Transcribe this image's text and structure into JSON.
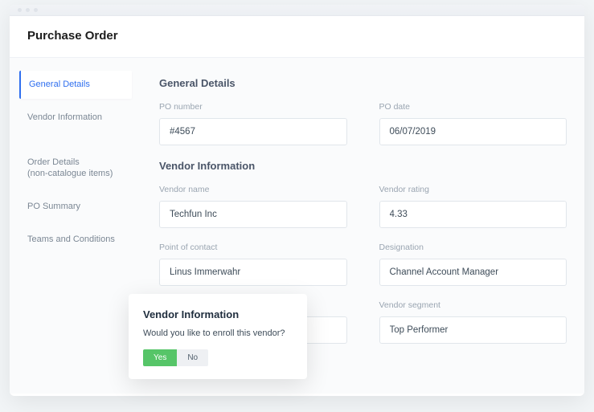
{
  "header": {
    "title": "Purchase Order"
  },
  "sidebar": {
    "items": [
      {
        "label": "General Details",
        "active": true
      },
      {
        "label": "Vendor Information"
      },
      {
        "label": "Order Details\n(non-catalogue items)"
      },
      {
        "label": "PO Summary"
      },
      {
        "label": "Teams and Conditions"
      }
    ]
  },
  "sections": {
    "general": {
      "title": "General Details",
      "po_number": {
        "label": "PO number",
        "value": "#4567"
      },
      "po_date": {
        "label": "PO date",
        "value": "06/07/2019"
      }
    },
    "vendor": {
      "title": "Vendor Information",
      "name": {
        "label": "Vendor name",
        "value": "Techfun Inc"
      },
      "rating": {
        "label": "Vendor rating",
        "value": "4.33"
      },
      "contact": {
        "label": "Point of contact",
        "value": "Linus Immerwahr"
      },
      "designation": {
        "label": "Designation",
        "value": "Channel Account Manager"
      },
      "segment": {
        "label": "Vendor segment",
        "value": "Top Performer"
      },
      "hidden_left_label": ""
    }
  },
  "dialog": {
    "title": "Vendor Information",
    "text": "Would you like to enroll this vendor?",
    "yes": "Yes",
    "no": "No"
  }
}
